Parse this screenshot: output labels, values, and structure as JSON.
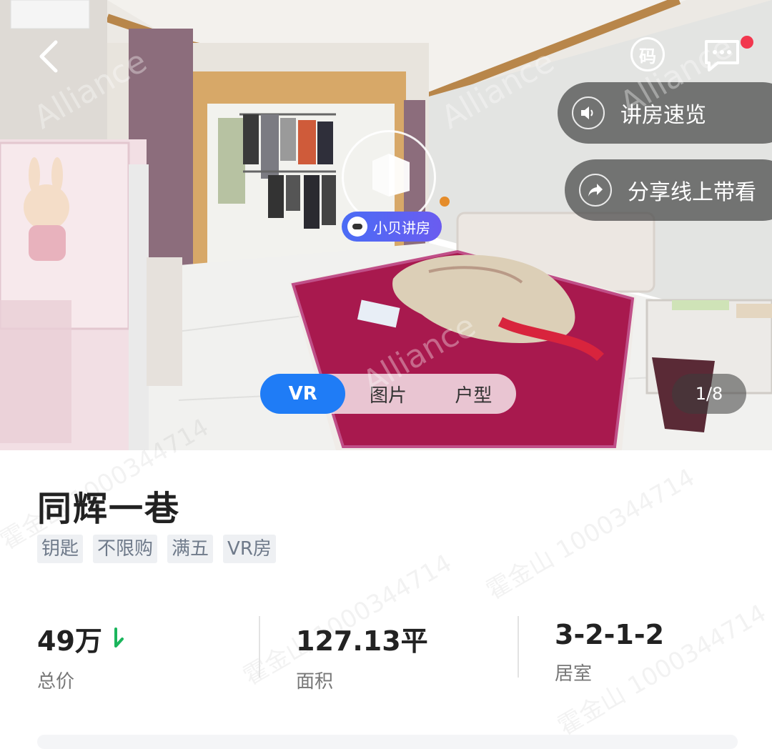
{
  "hero": {
    "brand_watermark": "Alliance",
    "vr_badge": "小贝讲房",
    "actions": [
      {
        "label": "讲房速览",
        "icon": "speaker-icon"
      },
      {
        "label": "分享线上带看",
        "icon": "share-arrow-icon"
      }
    ],
    "qr_label": "码",
    "tabs": [
      {
        "label": "VR",
        "active": true
      },
      {
        "label": "图片",
        "active": false
      },
      {
        "label": "户型",
        "active": false
      }
    ],
    "pager": "1/8",
    "has_unread_message": true
  },
  "listing": {
    "title": "同辉一巷",
    "tags": [
      "钥匙",
      "不限购",
      "满五",
      "VR房"
    ],
    "stats": [
      {
        "value": "49万",
        "label": "总价",
        "trend": "down"
      },
      {
        "value": "127.13平",
        "label": "面积"
      },
      {
        "value": "3-2-1-2",
        "label": "居室"
      }
    ],
    "watermark": "霍金山 1000344714"
  },
  "colors": {
    "accent": "#1f7cf6",
    "price_down": "#1bb55c",
    "badge_dot": "#f2374e",
    "tag_bg": "#eef0f3",
    "tag_text": "#6f7a8a"
  }
}
